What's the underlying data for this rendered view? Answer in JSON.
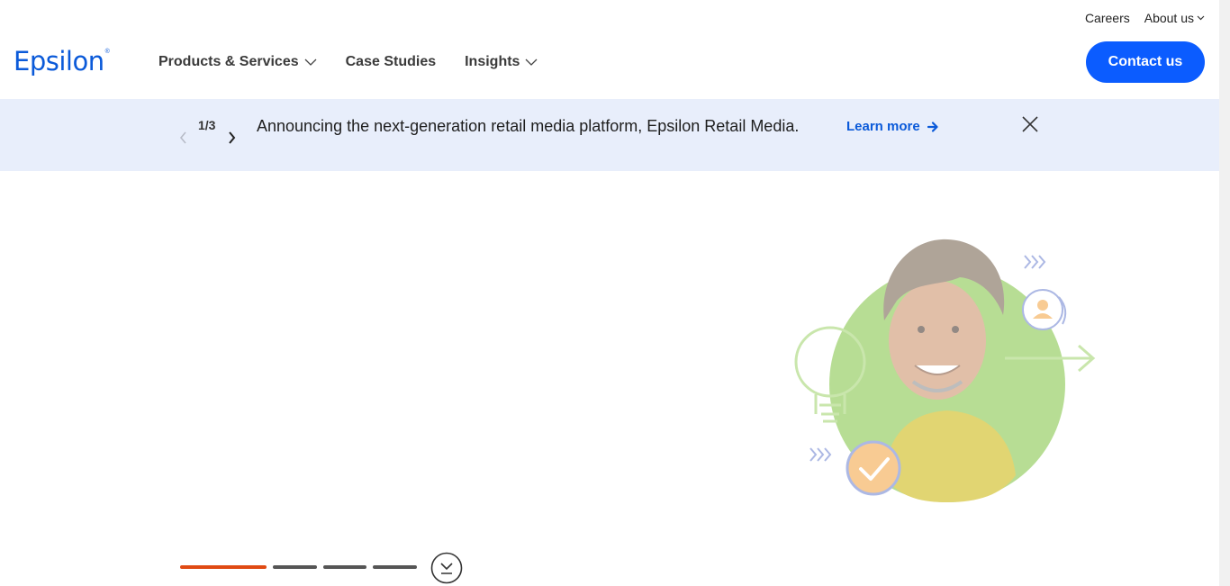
{
  "utility_nav": {
    "careers": "Careers",
    "about": "About us"
  },
  "logo": {
    "text": "Epsilon",
    "mark": "®"
  },
  "nav": {
    "items": [
      {
        "label": "Products & Services",
        "has_dropdown": true
      },
      {
        "label": "Case Studies",
        "has_dropdown": false
      },
      {
        "label": "Insights",
        "has_dropdown": true
      }
    ]
  },
  "contact_button": "Contact us",
  "announcement": {
    "counter": "1/3",
    "text": "Announcing the next-generation retail media platform, Epsilon Retail Media.",
    "link": "Learn more",
    "prev_icon": "chevron-left-icon",
    "next_icon": "chevron-right-icon",
    "close_icon": "close-icon"
  },
  "hero": {
    "progress_segments": 4,
    "active_segment": 1,
    "scroll_icon": "scroll-down-icon"
  },
  "colors": {
    "brand_blue": "#0b5ad9",
    "button_blue": "#0b5cff",
    "banner_bg": "#e8eefb",
    "progress_active": "#e04a13",
    "progress_inactive": "#555555"
  }
}
